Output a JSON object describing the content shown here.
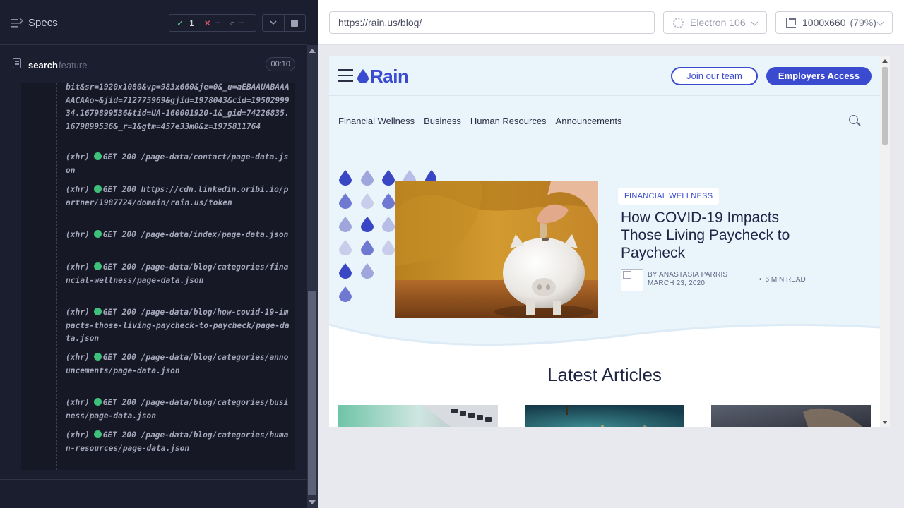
{
  "runner": {
    "specs_label": "Specs",
    "stats": {
      "passed": "1",
      "failed": "--",
      "pending": "--"
    },
    "spec": {
      "name": "search",
      "ext": "feature",
      "time": "00:10"
    },
    "log_entries": [
      {
        "text": "bit&sr=1920x1080&vp=983x660&je=0&_u=aEBAAUABAAAAACAAo~&jid=712775969&gjid=1978043&cid=1950299934.1679899536&tid=UA-160001920-1&_gid=74226835.1679899536&_r=1&gtm=457e33m0&z=1975811764"
      },
      {
        "kind": "(xhr)",
        "method": "GET 200",
        "url": "/page-data/contact/page-data.json"
      },
      {
        "kind": "(xhr)",
        "method": "GET 200",
        "url": "https://cdn.linkedin.oribi.io/partner/1987724/domain/rain.us/token"
      },
      {
        "kind": "(xhr)",
        "method": "GET 200",
        "url": "/page-data/index/page-data.json"
      },
      {
        "kind": "(xhr)",
        "method": "GET 200",
        "url": "/page-data/blog/categories/financial-wellness/page-data.json"
      },
      {
        "kind": "(xhr)",
        "method": "GET 200",
        "url": "/page-data/blog/how-covid-19-impacts-those-living-paycheck-to-paycheck/page-data.json"
      },
      {
        "kind": "(xhr)",
        "method": "GET 200",
        "url": "/page-data/blog/categories/announcements/page-data.json"
      },
      {
        "kind": "(xhr)",
        "method": "GET 200",
        "url": "/page-data/blog/categories/business/page-data.json"
      },
      {
        "kind": "(xhr)",
        "method": "GET 200",
        "url": "/page-data/blog/categories/human-resources/page-data.json"
      }
    ]
  },
  "aut": {
    "url": "https://rain.us/blog/",
    "browser": "Electron 106",
    "viewport": "1000x660",
    "zoom": "(79%)"
  },
  "site": {
    "logo": "Rain",
    "join_button": "Join our team",
    "employers_button": "Employers Access",
    "categories": [
      "Financial Wellness",
      "Business",
      "Human Resources",
      "Announcements"
    ],
    "featured": {
      "tag": "FINANCIAL WELLNESS",
      "title": "How COVID-19 Impacts Those Living Paycheck to Paycheck",
      "author": "BY ANASTASIA PARRIS",
      "date": "MARCH 23, 2020",
      "read_time": "6 MIN READ"
    },
    "latest_title": "Latest Articles"
  },
  "colors": {
    "brand": "#3a4bd0",
    "runner_bg": "#1b1e2e",
    "pass": "#5ec28b",
    "fail": "#e45770",
    "xhr_dot": "#3fc07a"
  }
}
